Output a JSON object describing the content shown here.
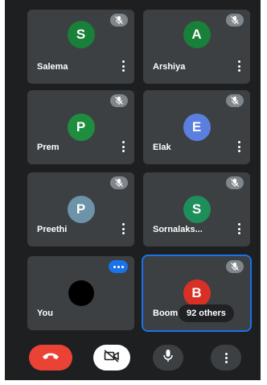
{
  "participants": [
    {
      "name": "Salema",
      "initial": "S",
      "color": "#188038"
    },
    {
      "name": "Arshiya",
      "initial": "A",
      "color": "#188038"
    },
    {
      "name": "Prem",
      "initial": "P",
      "color": "#1e8e3e"
    },
    {
      "name": "Elak",
      "initial": "E",
      "color": "#5b7fde"
    },
    {
      "name": "Preethi",
      "initial": "P",
      "color": "#6c93a8"
    },
    {
      "name": "Sornalaks...",
      "initial": "S",
      "color": "#1e8e5a"
    },
    {
      "name": "You",
      "initial": "",
      "color": "#000000"
    },
    {
      "name": "Boom",
      "initial": "B",
      "color": "#d93025"
    }
  ],
  "others_label": "92 others",
  "colors": {
    "background": "#1e1f21",
    "tile": "#3c4043",
    "end_call": "#ea4335",
    "active_outline": "#1a73e8"
  },
  "controls": [
    {
      "icon": "end-call-icon"
    },
    {
      "icon": "camera-off-icon"
    },
    {
      "icon": "microphone-icon"
    },
    {
      "icon": "more-options-icon"
    }
  ]
}
